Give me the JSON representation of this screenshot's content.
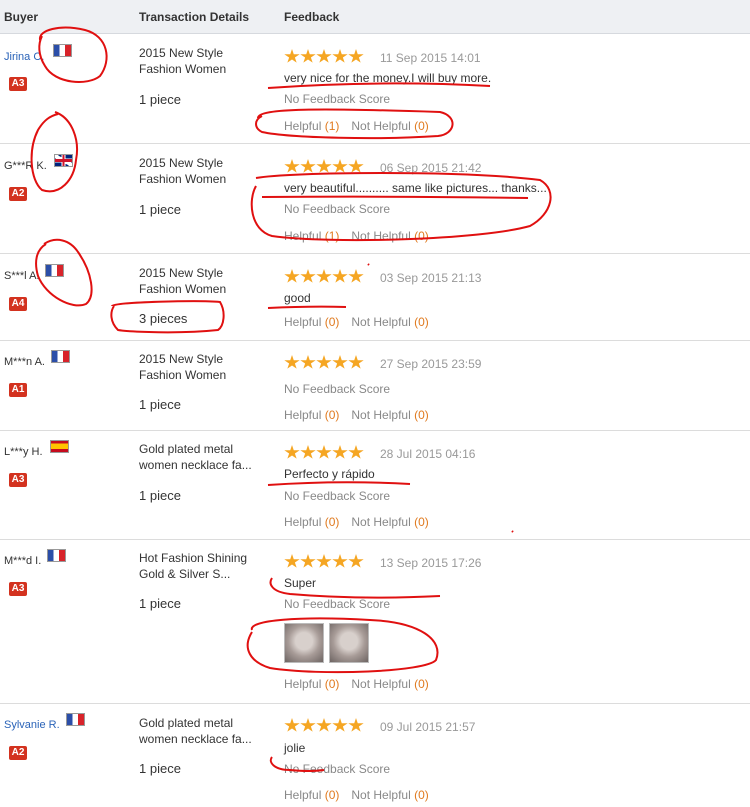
{
  "header": {
    "buyer": "Buyer",
    "transaction": "Transaction Details",
    "feedback": "Feedback"
  },
  "rows": [
    {
      "buyer": "Jirina C.",
      "badge": "A3",
      "product": "2015 New Style Fashion Women",
      "qty": "1 piece",
      "date": "11 Sep 2015 14:01",
      "comment": "very nice for the money.I will buy more.",
      "score": "No Feedback Score",
      "helpful_label": "Helpful",
      "helpful_count": "(1)",
      "not_helpful_label": "Not Helpful",
      "not_helpful_count": "(0)",
      "rating": 5
    },
    {
      "buyer": "G***R K.",
      "badge": "A2",
      "product": "2015 New Style Fashion Women",
      "qty": "1 piece",
      "date": "06 Sep 2015 21:42",
      "comment": "very beautiful.......... same like pictures... thanks...",
      "score": "No Feedback Score",
      "helpful_label": "Helpful",
      "helpful_count": "(1)",
      "not_helpful_label": "Not Helpful",
      "not_helpful_count": "(0)",
      "rating": 5
    },
    {
      "buyer": "S***l A.",
      "badge": "A4",
      "product": "2015 New Style Fashion Women",
      "qty": "3 pieces",
      "date": "03 Sep 2015 21:13",
      "comment": "good",
      "score": "",
      "helpful_label": "Helpful",
      "helpful_count": "(0)",
      "not_helpful_label": "Not Helpful",
      "not_helpful_count": "(0)",
      "rating": 5
    },
    {
      "buyer": "M***n A.",
      "badge": "A1",
      "product": "2015 New Style Fashion Women",
      "qty": "1 piece",
      "date": "27 Sep 2015 23:59",
      "comment": "",
      "score": "No Feedback Score",
      "helpful_label": "Helpful",
      "helpful_count": "(0)",
      "not_helpful_label": "Not Helpful",
      "not_helpful_count": "(0)",
      "rating": 5
    },
    {
      "buyer": "L***y H.",
      "badge": "A3",
      "product": "Gold plated metal women necklace fa...",
      "qty": "1 piece",
      "date": "28 Jul 2015 04:16",
      "comment": "Perfecto y rápido",
      "score": "No Feedback Score",
      "helpful_label": "Helpful",
      "helpful_count": "(0)",
      "not_helpful_label": "Not Helpful",
      "not_helpful_count": "(0)",
      "rating": 5
    },
    {
      "buyer": "M***d I.",
      "badge": "A3",
      "product": "Hot Fashion Shining Gold & Silver S...",
      "qty": "1 piece",
      "date": "13 Sep 2015 17:26",
      "comment": "Super",
      "score": "No Feedback Score",
      "helpful_label": "Helpful",
      "helpful_count": "(0)",
      "not_helpful_label": "Not Helpful",
      "not_helpful_count": "(0)",
      "rating": 5
    },
    {
      "buyer": "Sylvanie R.",
      "badge": "A2",
      "product": "Gold plated metal women necklace fa...",
      "qty": "1 piece",
      "date": "09 Jul 2015 21:57",
      "comment": "jolie",
      "score": "No Feedback Score",
      "helpful_label": "Helpful",
      "helpful_count": "(0)",
      "not_helpful_label": "Not Helpful",
      "not_helpful_count": "(0)",
      "rating": 5
    }
  ],
  "colors": {
    "badge": "#d3321f",
    "star": "#f5a623",
    "link": "#2a63b8",
    "count": "#e07a1f",
    "annotation": "#e01010"
  },
  "icons": {
    "flag_fr": "flag-france-icon",
    "flag_uk": "flag-uk-icon",
    "flag_es": "flag-spain-icon",
    "star": "star-icon"
  }
}
